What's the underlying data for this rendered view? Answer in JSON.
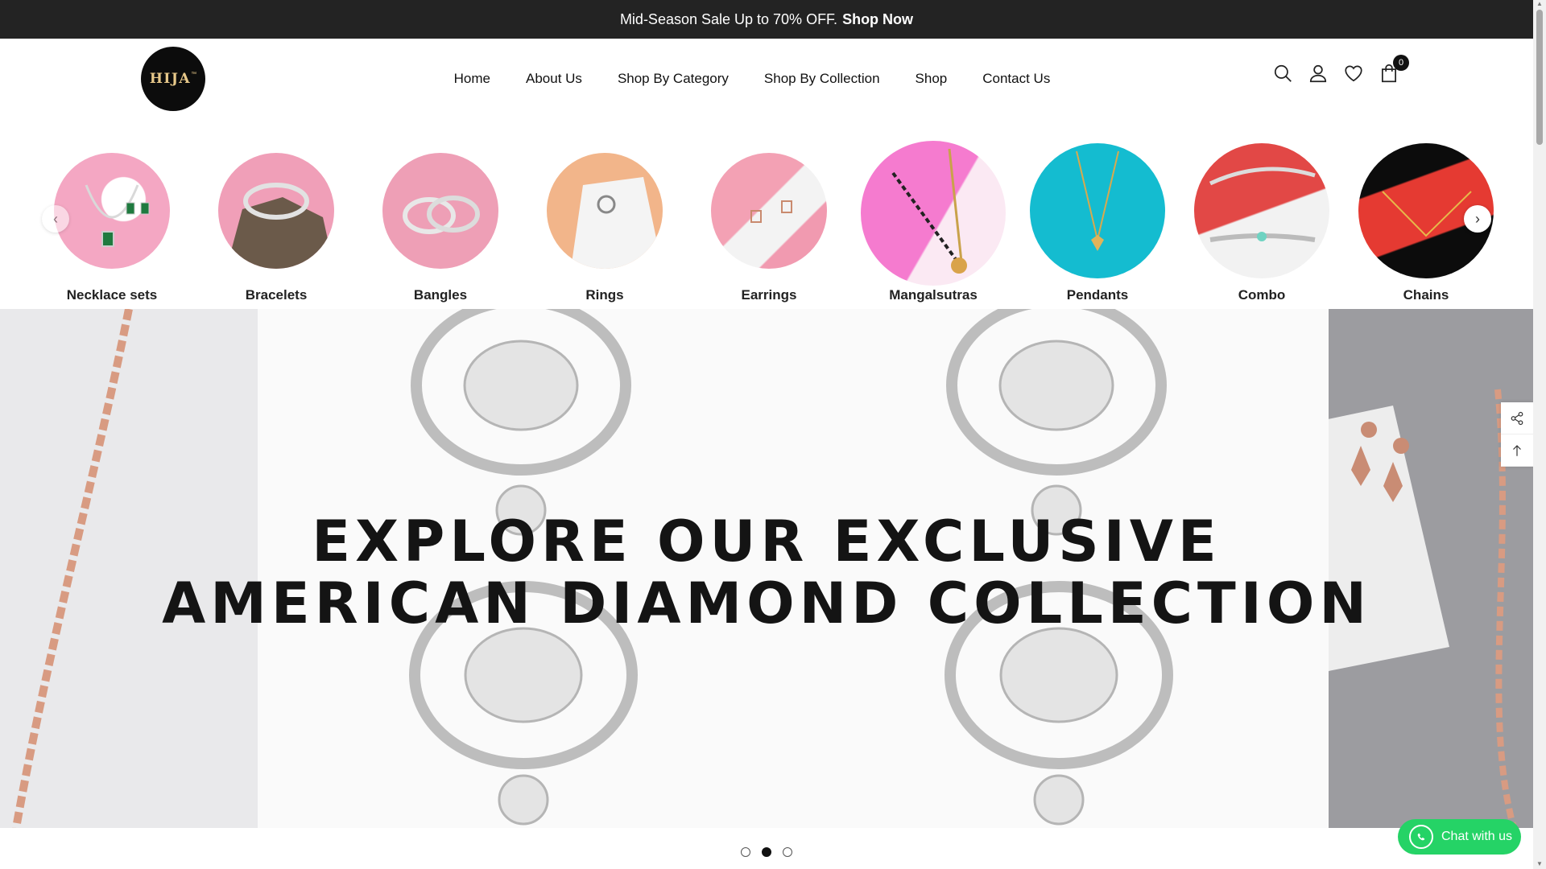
{
  "announcement": {
    "text": "Mid-Season Sale Up to 70% OFF.",
    "cta": "Shop Now"
  },
  "logo": {
    "text": "HIJA",
    "mark": "™"
  },
  "nav": {
    "items": [
      {
        "label": "Home"
      },
      {
        "label": "About Us"
      },
      {
        "label": "Shop By Category"
      },
      {
        "label": "Shop By Collection"
      },
      {
        "label": "Shop"
      },
      {
        "label": "Contact Us"
      }
    ]
  },
  "header_icons": {
    "search": "search-icon",
    "account": "user-icon",
    "wishlist": "heart-icon",
    "cart": "bag-icon",
    "cart_count": "0"
  },
  "categories": [
    {
      "label": "Necklace sets",
      "bg": "#f4a7c3"
    },
    {
      "label": "Bracelets",
      "bg": "#f09fb8"
    },
    {
      "label": "Bangles",
      "bg": "#ee9fb6"
    },
    {
      "label": "Rings",
      "bg": "#f2b58a"
    },
    {
      "label": "Earrings",
      "bg": "#f3a1b4"
    },
    {
      "label": "Mangalsutras",
      "bg": "#f57bcf"
    },
    {
      "label": "Pendants",
      "bg": "#14bcd0"
    },
    {
      "label": "Combo",
      "bg": "#e24846"
    },
    {
      "label": "Chains",
      "bg": "#e53a32"
    }
  ],
  "hero": {
    "line1": "EXPLORE OUR EXCLUSIVE",
    "line2": "AMERICAN DIAMOND COLLECTION",
    "slides": 3,
    "active_slide": 2
  },
  "chat": {
    "label": "Chat with us"
  },
  "colors": {
    "announcement_bg": "#232323",
    "chat_green": "#25d366",
    "hero_bg": "#c9c9cc"
  }
}
